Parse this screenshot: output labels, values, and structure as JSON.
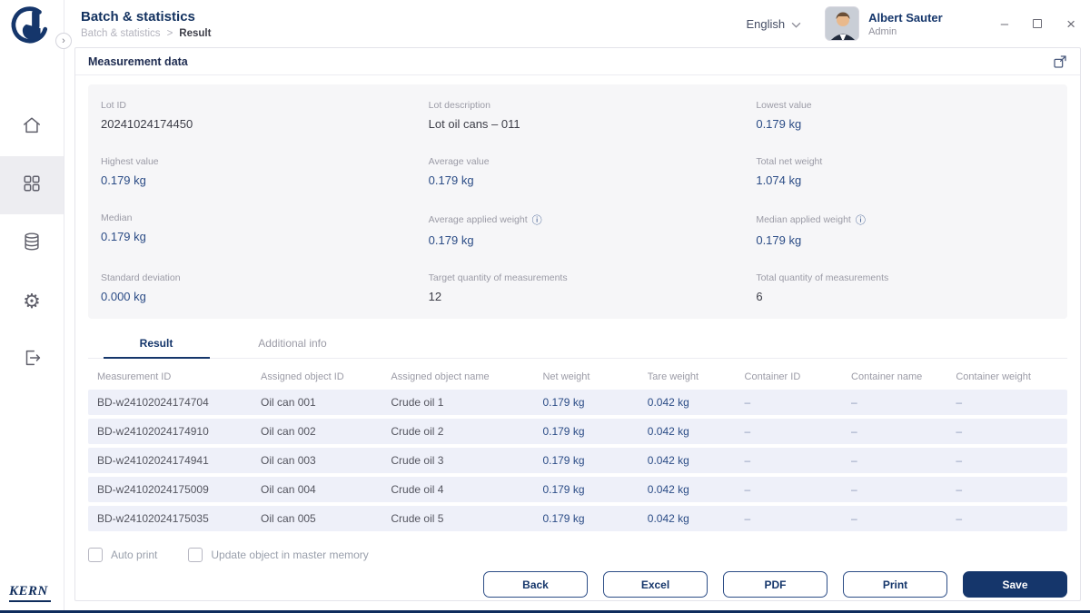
{
  "header": {
    "title": "Batch & statistics",
    "breadcrumb_root": "Batch & statistics",
    "breadcrumb_separator": ">",
    "breadcrumb_current": "Result",
    "language": "English",
    "user_name": "Albert Sauter",
    "user_role": "Admin"
  },
  "sidebar": {
    "brand": "KERN",
    "items": [
      {
        "name": "home",
        "active": false
      },
      {
        "name": "modules",
        "active": true
      },
      {
        "name": "database",
        "active": false
      },
      {
        "name": "settings",
        "active": false
      },
      {
        "name": "logout",
        "active": false
      }
    ]
  },
  "panel": {
    "title": "Measurement data",
    "stats": [
      {
        "label": "Lot ID",
        "value": "20241024174450",
        "style": "plain",
        "info": false
      },
      {
        "label": "Lot description",
        "value": "Lot oil cans – 011",
        "style": "plain",
        "info": false
      },
      {
        "label": "Lowest value",
        "value": "0.179 kg",
        "style": "accent",
        "info": false
      },
      {
        "label": "Highest value",
        "value": "0.179 kg",
        "style": "accent",
        "info": false
      },
      {
        "label": "Average value",
        "value": "0.179 kg",
        "style": "accent",
        "info": false
      },
      {
        "label": "Total net weight",
        "value": "1.074 kg",
        "style": "accent",
        "info": false
      },
      {
        "label": "Median",
        "value": "0.179 kg",
        "style": "accent",
        "info": false
      },
      {
        "label": "Average applied weight",
        "value": "0.179 kg",
        "style": "accent",
        "info": true
      },
      {
        "label": "Median applied weight",
        "value": "0.179 kg",
        "style": "accent",
        "info": true
      },
      {
        "label": "Standard deviation",
        "value": "0.000 kg",
        "style": "accent",
        "info": false
      },
      {
        "label": "Target quantity of measurements",
        "value": "12",
        "style": "plain",
        "info": false
      },
      {
        "label": "Total quantity of measurements",
        "value": "6",
        "style": "plain",
        "info": false
      }
    ],
    "tabs": [
      {
        "label": "Result",
        "active": true
      },
      {
        "label": "Additional info",
        "active": false
      }
    ],
    "table": {
      "headers": [
        "Measurement ID",
        "Assigned object ID",
        "Assigned object name",
        "Net weight",
        "Tare weight",
        "Container ID",
        "Container name",
        "Container weight"
      ],
      "rows": [
        [
          "BD-w24102024174704",
          "Oil can 001",
          "Crude oil 1",
          "0.179 kg",
          "0.042 kg",
          "–",
          "–",
          "–"
        ],
        [
          "BD-w24102024174910",
          "Oil can 002",
          "Crude oil 2",
          "0.179 kg",
          "0.042 kg",
          "–",
          "–",
          "–"
        ],
        [
          "BD-w24102024174941",
          "Oil can 003",
          "Crude oil 3",
          "0.179 kg",
          "0.042 kg",
          "–",
          "–",
          "–"
        ],
        [
          "BD-w24102024175009",
          "Oil can 004",
          "Crude oil 4",
          "0.179 kg",
          "0.042 kg",
          "–",
          "–",
          "–"
        ],
        [
          "BD-w24102024175035",
          "Oil can 005",
          "Crude oil 5",
          "0.179 kg",
          "0.042 kg",
          "–",
          "–",
          "–"
        ]
      ]
    },
    "checkboxes": [
      {
        "label": "Auto print",
        "checked": false
      },
      {
        "label": "Update object in master memory",
        "checked": false
      }
    ],
    "buttons": [
      {
        "label": "Back",
        "variant": "outline"
      },
      {
        "label": "Excel",
        "variant": "outline"
      },
      {
        "label": "PDF",
        "variant": "outline"
      },
      {
        "label": "Print",
        "variant": "outline"
      },
      {
        "label": "Save",
        "variant": "primary"
      }
    ]
  }
}
